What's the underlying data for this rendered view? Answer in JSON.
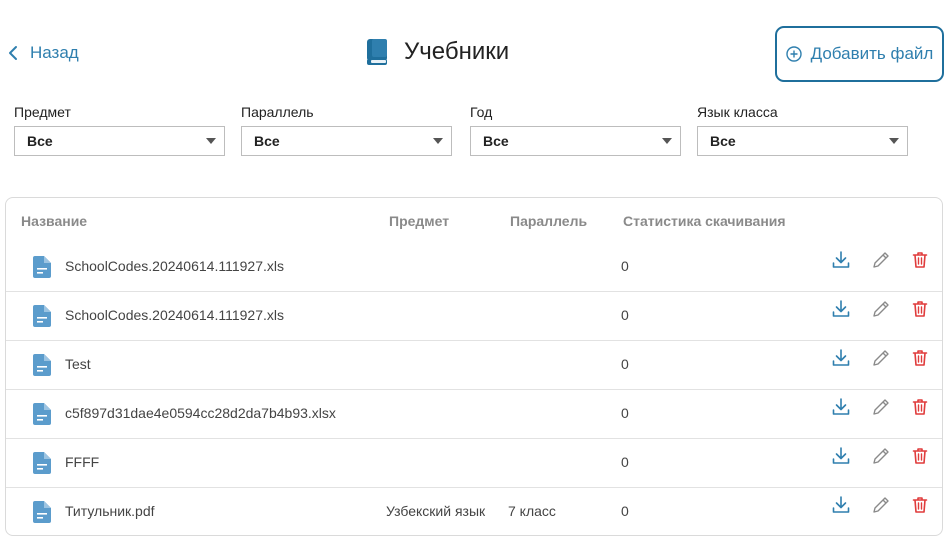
{
  "header": {
    "back_label": "Назад",
    "title": "Учебники",
    "add_button_label": "Добавить файл"
  },
  "filters": [
    {
      "label": "Предмет",
      "value": "Все"
    },
    {
      "label": "Параллель",
      "value": "Все"
    },
    {
      "label": "Год",
      "value": "Все"
    },
    {
      "label": "Язык класса",
      "value": "Все"
    }
  ],
  "table": {
    "columns": {
      "name": "Название",
      "subject": "Предмет",
      "parallel": "Параллель",
      "stats": "Статистика скачивания"
    },
    "rows": [
      {
        "name": "SchoolCodes.20240614.111927.xls",
        "subject": "",
        "parallel": "",
        "downloads": "0"
      },
      {
        "name": "SchoolCodes.20240614.111927.xls",
        "subject": "",
        "parallel": "",
        "downloads": "0"
      },
      {
        "name": "Test",
        "subject": "",
        "parallel": "",
        "downloads": "0"
      },
      {
        "name": "c5f897d31dae4e0594cc28d2da7b4b93.xlsx",
        "subject": "",
        "parallel": "",
        "downloads": "0"
      },
      {
        "name": "FFFF",
        "subject": "",
        "parallel": "",
        "downloads": "0"
      },
      {
        "name": "Титульник.pdf",
        "subject": "Узбекский язык",
        "parallel": "7 класс",
        "downloads": "0"
      }
    ]
  },
  "colors": {
    "accent": "#2f7fae",
    "file_icon": "#5b9ccc",
    "delete": "#e03c3c",
    "edit": "#8a8a8a"
  },
  "icons": {
    "back": "chevron-left-icon",
    "title": "book-icon",
    "add": "plus-circle-icon",
    "file": "file-icon",
    "download": "download-icon",
    "edit": "pencil-icon",
    "delete": "trash-icon"
  }
}
